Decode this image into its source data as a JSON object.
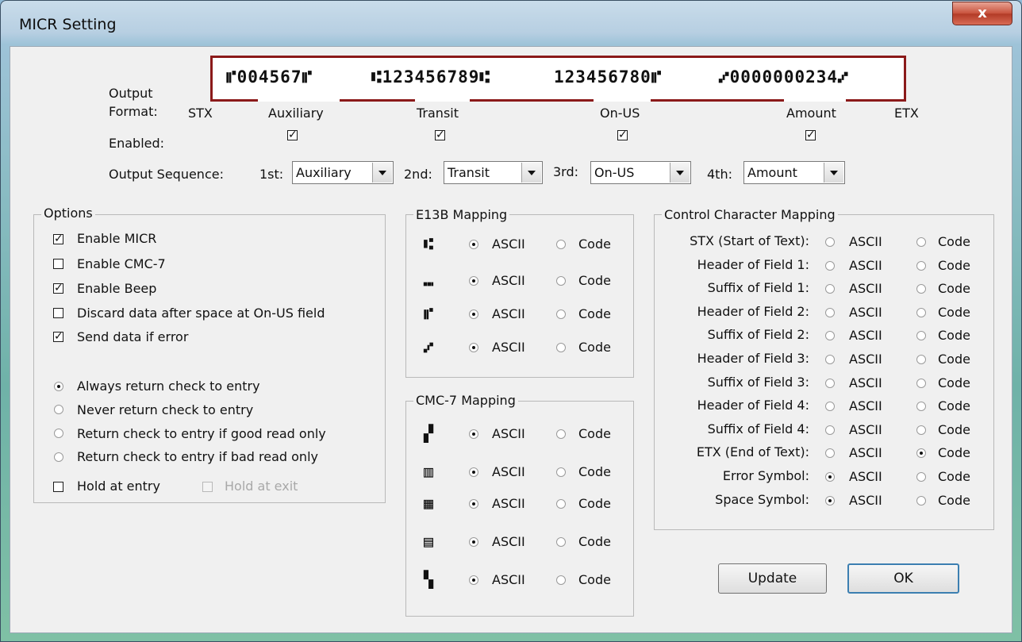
{
  "window": {
    "title": "MICR Setting",
    "close_glyph": "x"
  },
  "micr_line": {
    "aux": "⑈004567⑈",
    "transit": "⑆123456789⑆",
    "onus": "123456780⑈",
    "amount": "⑇0000000234⑇"
  },
  "output_format": {
    "label_line1": "Output",
    "label_line2": "Format:",
    "stx": "STX",
    "etx": "ETX",
    "fields": [
      "Auxiliary",
      "Transit",
      "On-US",
      "Amount"
    ],
    "enabled_label": "Enabled:",
    "enabled": [
      true,
      true,
      true,
      true
    ]
  },
  "sequence": {
    "label": "Output Sequence:",
    "items": [
      {
        "ordinal": "1st:",
        "value": "Auxiliary"
      },
      {
        "ordinal": "2nd:",
        "value": "Transit"
      },
      {
        "ordinal": "3rd:",
        "value": "On-US"
      },
      {
        "ordinal": "4th:",
        "value": "Amount"
      }
    ]
  },
  "options": {
    "title": "Options",
    "checks": [
      {
        "label": "Enable MICR",
        "checked": true
      },
      {
        "label": "Enable CMC-7",
        "checked": false
      },
      {
        "label": "Enable Beep",
        "checked": true
      },
      {
        "label": "Discard data after space at On-US field",
        "checked": false
      },
      {
        "label": "Send data if error",
        "checked": true
      }
    ],
    "return_mode": [
      {
        "label": "Always return check to entry",
        "selected": true
      },
      {
        "label": "Never return check to entry",
        "selected": false
      },
      {
        "label": "Return check to entry if good read only",
        "selected": false
      },
      {
        "label": "Return check to entry if bad read only",
        "selected": false
      }
    ],
    "hold_entry": {
      "label": "Hold at entry",
      "checked": false
    },
    "hold_exit": {
      "label": "Hold at exit",
      "checked": false,
      "disabled": true
    }
  },
  "e13b": {
    "title": "E13B Mapping",
    "ascii": "ASCII",
    "code": "Code",
    "rows": [
      {
        "symbol": "⑆",
        "mode": "ASCII"
      },
      {
        "symbol": "⑉",
        "mode": "ASCII"
      },
      {
        "symbol": "⑈",
        "mode": "ASCII"
      },
      {
        "symbol": "⑇",
        "mode": "ASCII"
      }
    ]
  },
  "cmc7": {
    "title": "CMC-7 Mapping",
    "ascii": "ASCII",
    "code": "Code",
    "rows": [
      {
        "symbol": "▞",
        "mode": "ASCII"
      },
      {
        "symbol": "▥",
        "mode": "ASCII"
      },
      {
        "symbol": "▦",
        "mode": "ASCII"
      },
      {
        "symbol": "▤",
        "mode": "ASCII"
      },
      {
        "symbol": "▚",
        "mode": "ASCII"
      }
    ]
  },
  "control": {
    "title": "Control Character Mapping",
    "ascii": "ASCII",
    "code": "Code",
    "rows": [
      {
        "label": "STX (Start of Text):",
        "mode": "none"
      },
      {
        "label": "Header of Field 1:",
        "mode": "none"
      },
      {
        "label": "Suffix of Field 1:",
        "mode": "none"
      },
      {
        "label": "Header of Field 2:",
        "mode": "none"
      },
      {
        "label": "Suffix of Field 2:",
        "mode": "none"
      },
      {
        "label": "Header of Field 3:",
        "mode": "none"
      },
      {
        "label": "Suffix of Field 3:",
        "mode": "none"
      },
      {
        "label": "Header of Field 4:",
        "mode": "none"
      },
      {
        "label": "Suffix of Field 4:",
        "mode": "none"
      },
      {
        "label": "ETX (End of Text):",
        "mode": "Code"
      },
      {
        "label": "Error Symbol:",
        "mode": "ASCII"
      },
      {
        "label": "Space Symbol:",
        "mode": "ASCII"
      }
    ]
  },
  "buttons": {
    "update": "Update",
    "ok": "OK"
  }
}
